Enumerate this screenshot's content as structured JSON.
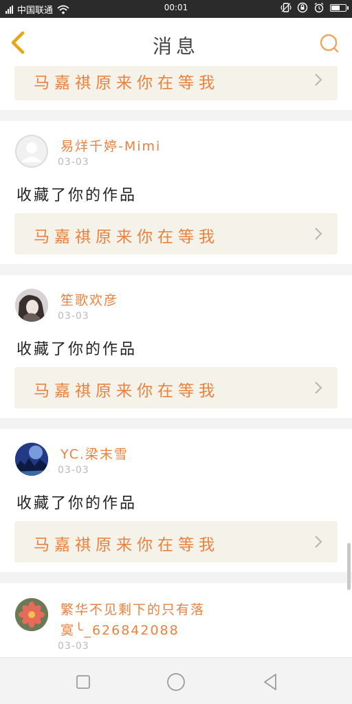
{
  "status_bar": {
    "carrier": "中国联通",
    "time": "00:01"
  },
  "header": {
    "title": "消息"
  },
  "items": [
    {
      "work_title": "马嘉祺原来你在等我"
    },
    {
      "user": "易烊千婷-Mimi",
      "date": "03-03",
      "action": "收藏了你的作品",
      "work_title": "马嘉祺原来你在等我"
    },
    {
      "user": "笙歌欢彦",
      "date": "03-03",
      "action": "收藏了你的作品",
      "work_title": "马嘉祺原来你在等我"
    },
    {
      "user": "YC.梁末雪",
      "date": "03-03",
      "action": "收藏了你的作品",
      "work_title": "马嘉祺原来你在等我"
    },
    {
      "user_line1": "繁华不见剩下的只有落",
      "user_line2": "寞╰_626842088",
      "date": "03-03"
    }
  ],
  "icons": {
    "back": "chevron-left-icon",
    "search": "search-icon",
    "recent": "square-icon",
    "home": "circle-icon",
    "nav_back": "triangle-back-icon"
  },
  "colors": {
    "accent": "#e9813f",
    "back_arrow": "#e8a614",
    "card_link_bg": "#f4f2e9"
  }
}
